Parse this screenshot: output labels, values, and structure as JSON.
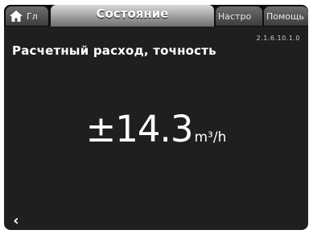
{
  "tabs": {
    "home_label": "Гл",
    "active_label": "Состояние",
    "settings_label": "Настро",
    "help_label": "Помощь"
  },
  "version": "2.1.6.10.1.0",
  "page_title": "Расчетный расход, точность",
  "measurement": {
    "value": "±14.3",
    "unit": "m³/h"
  },
  "navigation": {
    "back_symbol": "‹"
  },
  "icons": {
    "home": "home-icon",
    "back": "chevron-left-icon"
  },
  "colors": {
    "screen_background": "#1f1f1f",
    "tab_bar": "#0e0e0e",
    "active_tab": "#a9a9a9",
    "text": "#ffffff"
  }
}
